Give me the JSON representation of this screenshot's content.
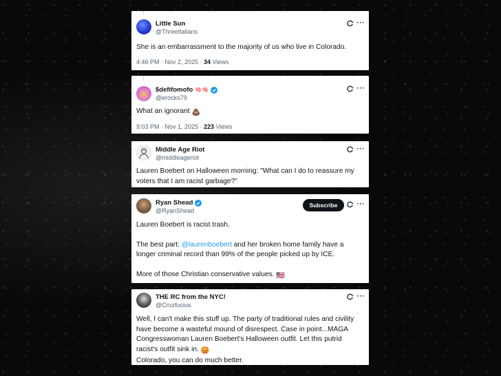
{
  "tweets": [
    {
      "name": "Little Sun",
      "handle": "@ThreeItalians",
      "text": "She is an embarrassment to the majority of us who live in Colorado.",
      "time": "4:46 PM · Nov 2, 2025 · ",
      "views_count": "34",
      "views_label": " Views"
    },
    {
      "name": "$defifomofo",
      "name_emoji": "🧠🧠",
      "handle": "@erocks79",
      "text": "What an ignorant",
      "text_emoji": "💩",
      "time": "9:03 PM · Nov 1, 2025 · ",
      "views_count": "223",
      "views_label": " Views"
    },
    {
      "name": "Middle Age Riot",
      "handle": "@middleageriot",
      "text": "Lauren Boebert on Halloween morning: \"What can I do to reassure my voters that I am racist garbage?\""
    },
    {
      "name": "Ryan Shead",
      "handle": "@RyanShead",
      "subscribe_label": "Subscribe",
      "p1": "Lauren Boebert is racist trash.",
      "p2_prefix": "The best part: ",
      "p2_mention": "@laurenboebert",
      "p2_rest": " and her broken home family have a longer criminal record than 99% of the people picked up by ICE.",
      "p3": "More of those Christian conservative values.",
      "p3_emoji": "🇺🇸"
    },
    {
      "name": "THE RC from the NYC!",
      "handle": "@Cruzfucius",
      "text": "Well, I can't make this stuff up.  The party of traditional rules and civility have become a wasteful mound of disrespect.  Case in point...MAGA Congresswoman Lauren Boebert's Halloween outfit.  Let this putrid racist's outfit sink in.",
      "text_emoji": "😡",
      "text2": "Colorado, you can do much better."
    }
  ],
  "icons": {
    "more": "···"
  },
  "colors": {
    "accent": "#1d9bf0",
    "text": "#0f1419",
    "muted": "#536471"
  }
}
